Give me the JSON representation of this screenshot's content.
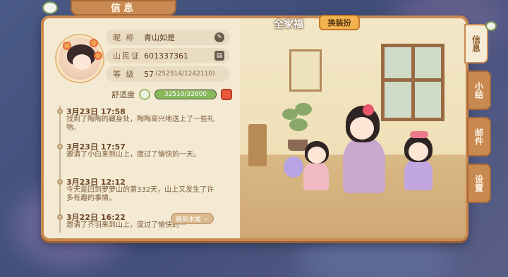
{
  "header": {
    "title": "信息"
  },
  "profile": {
    "nickname_label": "昵 称",
    "nickname": "青山如是",
    "id_label": "山民证",
    "id_value": "601337361",
    "level_label": "等 级",
    "level_value": "57",
    "level_progress": "(252514/1242110)",
    "comfort_label": "舒适度",
    "comfort_value": "32510/32600",
    "comfort_fraction": 0.997
  },
  "log": {
    "entries": [
      {
        "time": "3月23日 17:58",
        "text": "找到了陶陶的藏身处，陶陶高兴地送上了一些礼物。"
      },
      {
        "time": "3月23日 17:57",
        "text": "邀请了小白来到山上，度过了愉快的一天。"
      },
      {
        "time": "3月23日 12:12",
        "text": "今天是回到萝萝山的第332天，山上又发生了许多有趣的事情。"
      },
      {
        "time": "3月22日 16:22",
        "text": "邀请了齐羽来到山上，度过了愉快的一"
      }
    ],
    "jump_label": "跳到末尾"
  },
  "scene": {
    "title": "全家福",
    "outfit_button": "换装扮"
  },
  "side_tabs": [
    {
      "label": "信息",
      "active": true
    },
    {
      "label": "小结",
      "active": false
    },
    {
      "label": "邮件",
      "active": false
    },
    {
      "label": "设置",
      "active": false
    }
  ],
  "colors": {
    "panel": "#f6ecd6",
    "frame": "#c98a52",
    "accent": "#f2b24e",
    "bar_fill": "#89b85b"
  },
  "icons": [
    "edit-icon",
    "id-card-icon",
    "pet-icon",
    "gift-icon",
    "chevron-down-icon",
    "sprout-icon"
  ]
}
